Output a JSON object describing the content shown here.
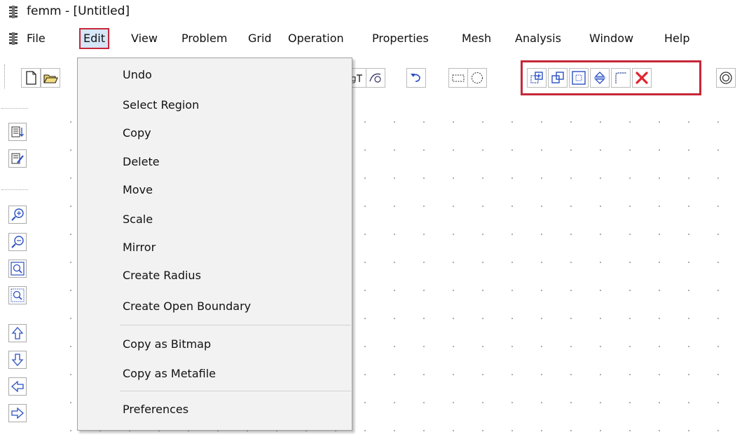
{
  "window": {
    "title": "femm - [Untitled]"
  },
  "menubar": {
    "items": [
      {
        "label": "File"
      },
      {
        "label": "Edit"
      },
      {
        "label": "View"
      },
      {
        "label": "Problem"
      },
      {
        "label": "Grid"
      },
      {
        "label": "Operation"
      },
      {
        "label": "Properties"
      },
      {
        "label": "Mesh"
      },
      {
        "label": "Analysis"
      },
      {
        "label": "Window"
      },
      {
        "label": "Help"
      }
    ],
    "active": "Edit"
  },
  "edit_menu": {
    "items": [
      {
        "label": "Undo"
      },
      {
        "label": "Select Region"
      },
      {
        "label": "Copy"
      },
      {
        "label": "Delete"
      },
      {
        "label": "Move"
      },
      {
        "label": "Scale"
      },
      {
        "label": "Mirror"
      },
      {
        "label": "Create Radius"
      },
      {
        "label": "Create Open Boundary"
      },
      {
        "label": "Copy as Bitmap"
      },
      {
        "label": "Copy as Metafile"
      },
      {
        "label": "Preferences"
      }
    ]
  },
  "toolbar": {
    "icons": [
      "new-document-icon",
      "open-folder-icon",
      "group-icon",
      "circle-arc-icon",
      "undo-icon",
      "select-rectangle-icon",
      "select-circle-icon",
      "copy-icon",
      "move-icon",
      "scale-icon",
      "mirror-icon",
      "create-radius-icon",
      "delete-icon",
      "open-boundary-icon"
    ],
    "highlight_color": "#c62839",
    "delete_color": "#e0242c"
  },
  "left_toolbar": {
    "icons": [
      "show-list-icon",
      "edit-list-icon",
      "zoom-in-icon",
      "zoom-out-icon",
      "zoom-natural-icon",
      "zoom-window-icon",
      "pan-up-icon",
      "pan-down-icon",
      "pan-left-icon",
      "pan-right-icon"
    ]
  }
}
